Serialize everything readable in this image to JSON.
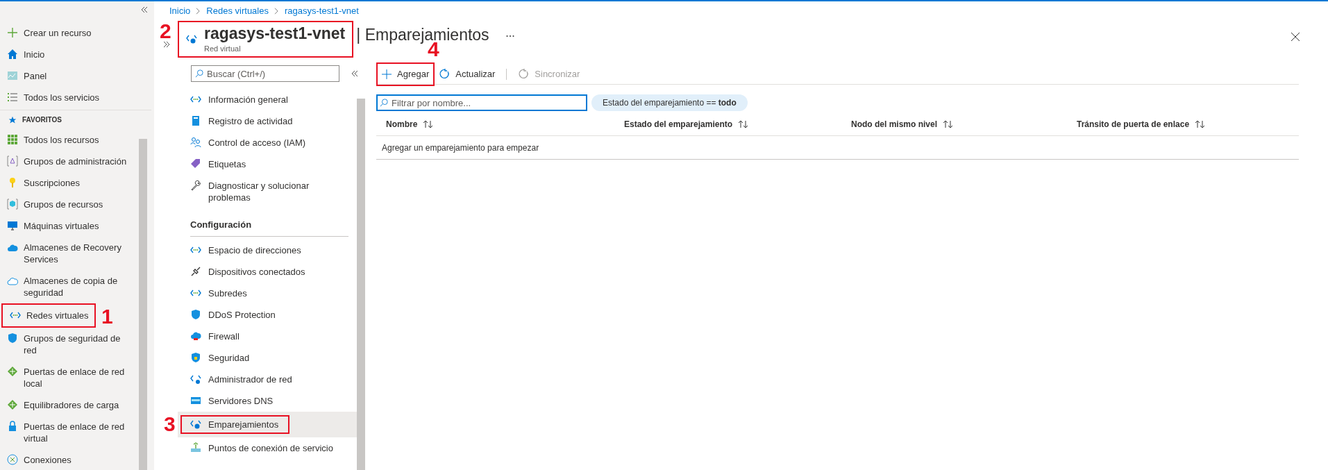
{
  "sidebar": {
    "top_items": [
      {
        "label": "Crear un recurso"
      },
      {
        "label": "Inicio"
      },
      {
        "label": "Panel"
      },
      {
        "label": "Todos los servicios"
      }
    ],
    "favorites_header": "FAVORITOS",
    "favorites": [
      {
        "label": "Todos los recursos"
      },
      {
        "label": "Grupos de administración"
      },
      {
        "label": "Suscripciones"
      },
      {
        "label": "Grupos de recursos"
      },
      {
        "label": "Máquinas virtuales"
      },
      {
        "label": "Almacenes de Recovery Services"
      },
      {
        "label": "Almacenes de copia de seguridad"
      },
      {
        "label": "Redes virtuales",
        "annotation": "1"
      },
      {
        "label": "Grupos de seguridad de red"
      },
      {
        "label": "Puertas de enlace de red local"
      },
      {
        "label": "Equilibradores de carga"
      },
      {
        "label": "Puertas de enlace de red virtual"
      },
      {
        "label": "Conexiones"
      }
    ]
  },
  "breadcrumb": [
    "Inicio",
    "Redes virtuales",
    "ragasys-test1-vnet"
  ],
  "blade": {
    "resource_name": "ragasys-test1-vnet",
    "page_title": "| Emparejamientos",
    "resource_type": "Red virtual",
    "header_annotation": "2"
  },
  "menu": {
    "search": {
      "placeholder": "Buscar (Ctrl+/)"
    },
    "items": [
      {
        "label": "Información general",
        "selected": false
      },
      {
        "label": "Registro de actividad",
        "selected": false
      },
      {
        "label": "Control de acceso (IAM)",
        "selected": false
      },
      {
        "label": "Etiquetas",
        "selected": false
      },
      {
        "label": "Diagnosticar y solucionar problemas",
        "selected": false
      }
    ],
    "section": "Configuración",
    "config_items": [
      {
        "label": "Espacio de direcciones",
        "selected": false
      },
      {
        "label": "Dispositivos conectados",
        "selected": false
      },
      {
        "label": "Subredes",
        "selected": false
      },
      {
        "label": "DDoS Protection",
        "selected": false
      },
      {
        "label": "Firewall",
        "selected": false
      },
      {
        "label": "Seguridad",
        "selected": false
      },
      {
        "label": "Administrador de red",
        "selected": false
      },
      {
        "label": "Servidores DNS",
        "selected": false
      },
      {
        "label": "Emparejamientos",
        "selected": true,
        "annotation": "3"
      },
      {
        "label": "Puntos de conexión de servicio",
        "selected": false
      }
    ]
  },
  "toolbar": [
    {
      "label": "Agregar",
      "disabled": false,
      "annotation": "4"
    },
    {
      "label": "Actualizar",
      "disabled": false
    },
    {
      "label": "Sincronizar",
      "disabled": true
    }
  ],
  "filter": {
    "placeholder": "Filtrar por nombre...",
    "chip": "Estado del emparejamiento == **todo**"
  },
  "table": {
    "columns": [
      "Nombre",
      "Estado del emparejamiento",
      "Nodo del mismo nivel",
      "Tránsito de puerta de enlace"
    ],
    "empty_message": "Agregar un emparejamiento para empezar"
  }
}
